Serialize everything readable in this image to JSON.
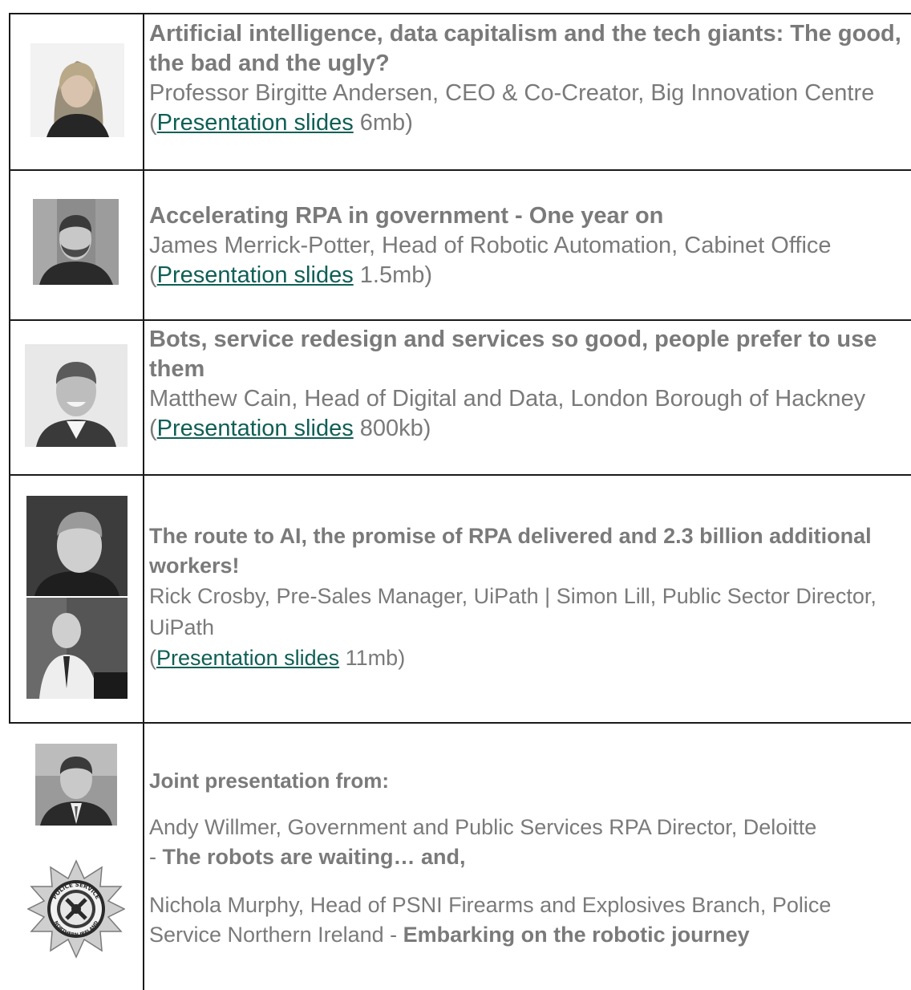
{
  "rows": [
    {
      "title": "Artificial intelligence, data capitalism and the tech giants: The good, the bad and the ugly?",
      "speaker": "Professor Birgitte Andersen, CEO & Co-Creator, Big Innovation Centre",
      "link_label": "Presentation slides",
      "size": "6mb",
      "photo": "portrait-woman-photo"
    },
    {
      "title": "Accelerating RPA in government - One year on",
      "speaker": "James Merrick-Potter, Head of Robotic Automation, Cabinet Office",
      "link_label": "Presentation slides",
      "size": "1.5mb",
      "photo": "portrait-bearded-man-photo"
    },
    {
      "title": "Bots, service redesign and services so good, people prefer to use them",
      "speaker": "Matthew Cain, Head of Digital and Data, London Borough of Hackney",
      "link_label": "Presentation slides",
      "size": "800kb",
      "photo": "portrait-man-smiling-photo"
    },
    {
      "title": "The route to AI, the promise of RPA delivered and 2.3 billion additional workers!",
      "speaker": "Rick Crosby, Pre-Sales Manager, UiPath | Simon Lill, Public Sector Director, UiPath",
      "link_label": "Presentation slides",
      "size": "11mb",
      "photo": "portrait-two-men-photo"
    },
    {
      "intro": "Joint presentation from:",
      "speaker_a": "Andy Willmer, Government and Public Services RPA Director, Deloitte",
      "talk_a": "The robots are waiting… and,",
      "speaker_b": "Nichola Murphy, Head of PSNI Firearms and Explosives Branch, Police Service Northern Ireland",
      "talk_b": "Embarking on the robotic journey",
      "photo": "portrait-man-suit-photo",
      "badge": "police-service-northern-ireland-badge",
      "badge_text_top": "POLICE SERVICE",
      "badge_text_bottom": "NORTHERN IRELAND"
    }
  ],
  "colors": {
    "text": "#7a7a7a",
    "link": "#0e5f55",
    "border": "#1a1a1a"
  }
}
